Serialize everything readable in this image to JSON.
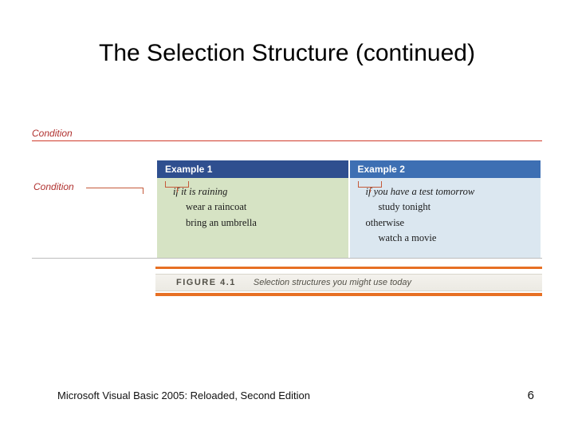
{
  "title": "The Selection Structure (continued)",
  "condition_label_top": "Condition",
  "condition_label_mid": "Condition",
  "examples": {
    "header1": "Example 1",
    "header2": "Example 2",
    "ex1": {
      "if": "if it is raining",
      "line2": "wear a raincoat",
      "line3": "bring an umbrella"
    },
    "ex2": {
      "if": "if you have a test tomorrow",
      "line2": "study tonight",
      "line3": "otherwise",
      "line4": "watch a movie"
    }
  },
  "figure": {
    "label": "FIGURE 4.1",
    "caption": "Selection structures you might use today"
  },
  "footer_text": "Microsoft Visual Basic 2005: Reloaded, Second Edition",
  "page_number": "6"
}
